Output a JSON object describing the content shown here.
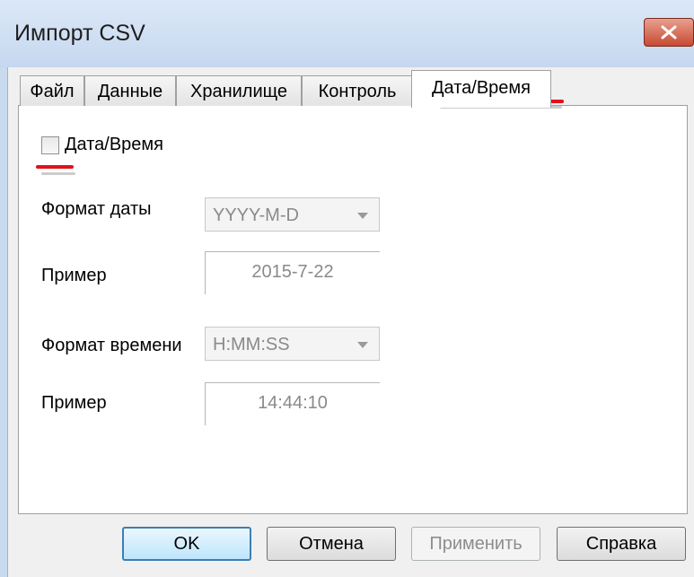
{
  "window": {
    "title": "Импорт CSV",
    "close_icon": "close-x-icon",
    "close_color": "#c74a32"
  },
  "tabs": [
    {
      "label": "Файл",
      "active": false
    },
    {
      "label": "Данные",
      "active": false
    },
    {
      "label": "Хранилище",
      "active": false
    },
    {
      "label": "Контроль",
      "active": false
    },
    {
      "label": "Дата/Время",
      "active": true
    }
  ],
  "panel": {
    "datetime_checkbox": {
      "label": "Дата/Время",
      "checked": false
    },
    "date_format": {
      "label": "Формат даты",
      "value": "YYYY-M-D"
    },
    "date_example": {
      "label": "Пример",
      "value": "2015-7-22"
    },
    "time_format": {
      "label": "Формат времени",
      "value": "H:MM:SS"
    },
    "time_example": {
      "label": "Пример",
      "value": "14:44:10"
    }
  },
  "buttons": {
    "ok": "OK",
    "cancel": "Отмена",
    "apply": "Применить",
    "help": "Справка"
  },
  "annotation_color": "#e0121a"
}
